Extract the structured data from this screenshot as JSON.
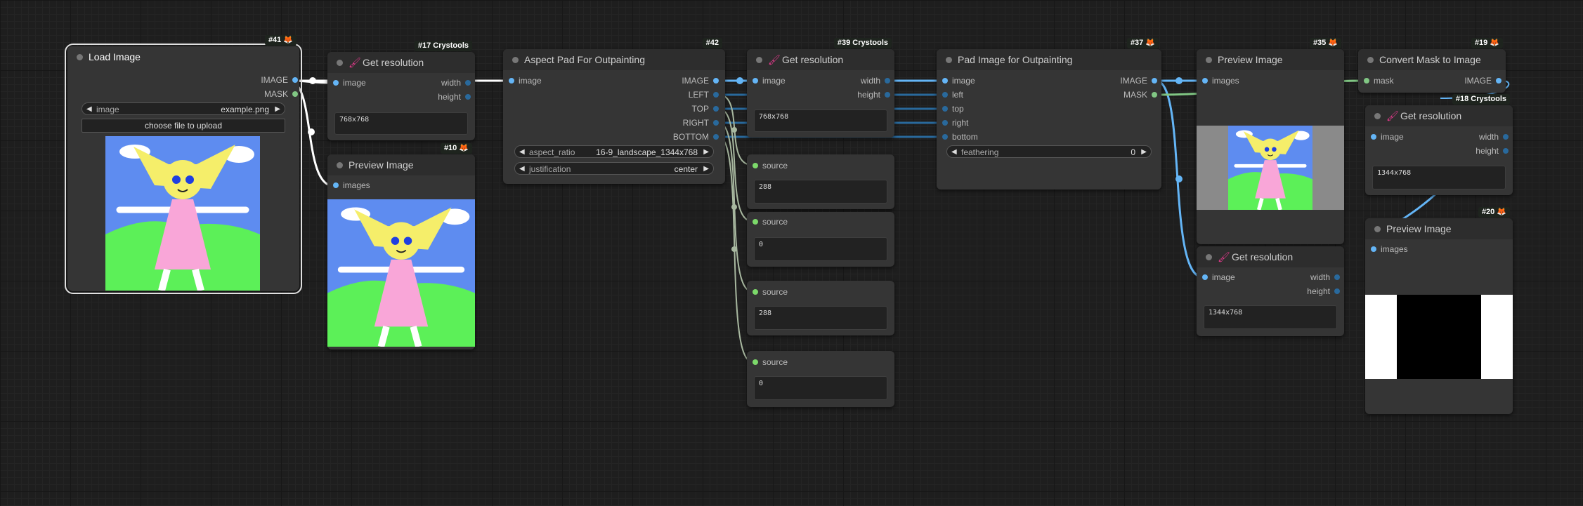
{
  "colors": {
    "canvas": "#1e1e1e",
    "node_body": "#353535",
    "node_title": "#2d2d2d",
    "image_wire": "#64b5f6",
    "mask_wire": "#81c784",
    "int_wire": "#29699c",
    "link_white": "#ffffff",
    "source_wire": "#a8b8a0",
    "title_icon": "#e0398a",
    "fox": "#ff8a1f"
  },
  "icons": {
    "node_icon": "brush-icon",
    "badge_icon": "fox-icon"
  },
  "nodes": {
    "load_image": {
      "id": "#41",
      "title": "Load Image",
      "outputs": [
        "IMAGE",
        "MASK"
      ],
      "image_label": "image",
      "image_value": "example.png",
      "upload_label": "choose file to upload"
    },
    "get_res_17": {
      "id": "#17 Crystools",
      "title": "Get resolution",
      "input": "image",
      "outputs": [
        "width",
        "height"
      ],
      "text": "768x768"
    },
    "preview_10": {
      "id": "#10",
      "title": "Preview Image",
      "input": "images"
    },
    "aspect_pad": {
      "id": "#42",
      "title": "Aspect Pad For Outpainting",
      "input": "image",
      "outputs": [
        "IMAGE",
        "LEFT",
        "TOP",
        "RIGHT",
        "BOTTOM"
      ],
      "aspect_label": "aspect_ratio",
      "aspect_value": "16-9_landscape_1344x768",
      "just_label": "justification",
      "just_value": "center"
    },
    "get_res_39": {
      "id": "#39 Crystools",
      "title": "Get resolution",
      "input": "image",
      "outputs": [
        "width",
        "height"
      ],
      "text": "768x768"
    },
    "source_nodes": [
      {
        "label": "source",
        "value": "288"
      },
      {
        "label": "source",
        "value": "0"
      },
      {
        "label": "source",
        "value": "288"
      },
      {
        "label": "source",
        "value": "0"
      }
    ],
    "pad_image": {
      "id": "#37",
      "title": "Pad Image for Outpainting",
      "inputs": [
        "image",
        "left",
        "top",
        "right",
        "bottom"
      ],
      "outputs": [
        "IMAGE",
        "MASK"
      ],
      "feather_label": "feathering",
      "feather_value": "0"
    },
    "preview_35": {
      "id": "#35",
      "title": "Preview Image",
      "input": "images"
    },
    "get_res_bottom": {
      "title": "Get resolution",
      "input": "image",
      "outputs": [
        "width",
        "height"
      ],
      "text": "1344x768"
    },
    "convert_mask": {
      "id": "#19",
      "title": "Convert Mask to Image",
      "input": "mask",
      "output": "IMAGE"
    },
    "get_res_18": {
      "id": "#18 Crystools",
      "title": "Get resolution",
      "input": "image",
      "outputs": [
        "width",
        "height"
      ],
      "text": "1344x768"
    },
    "preview_20": {
      "id": "#20",
      "title": "Preview Image",
      "input": "images"
    }
  }
}
